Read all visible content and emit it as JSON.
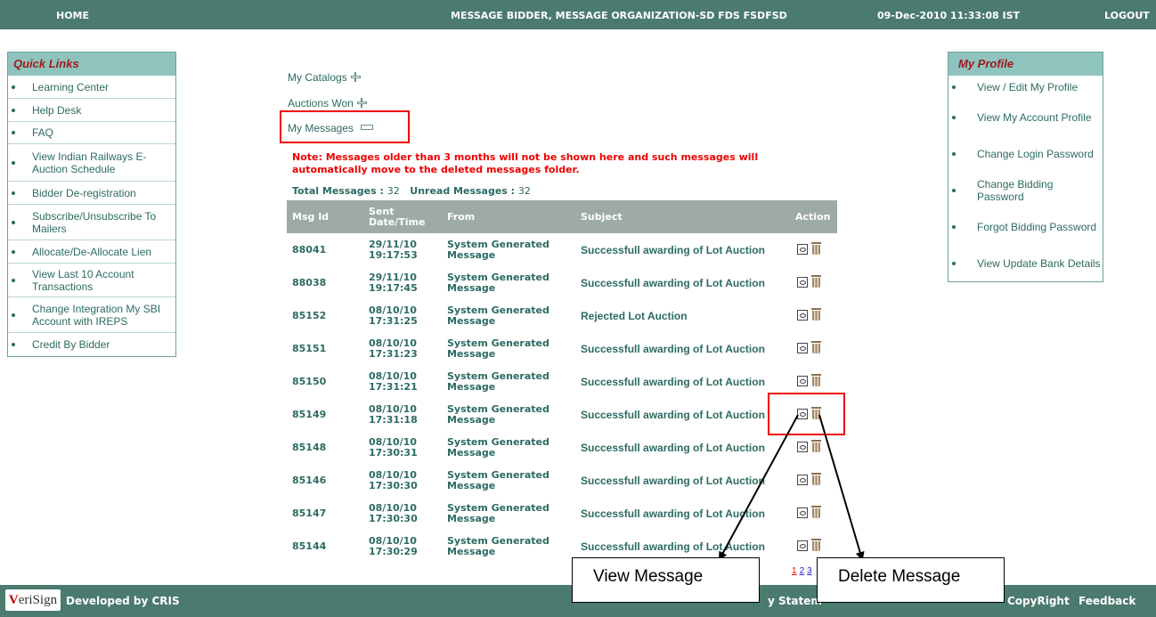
{
  "header": {
    "home": "HOME",
    "user": "MESSAGE BIDDER, MESSAGE ORGANIZATION-SD FDS FSDFSD",
    "datetime": "09-Dec-2010 11:33:08 IST",
    "logout": "LOGOUT"
  },
  "quick_links": {
    "title": "Quick Links",
    "items": [
      "Learning Center",
      "Help Desk",
      "FAQ",
      "View Indian Railways E-Auction Schedule",
      "Bidder De-registration",
      "Subscribe/Unsubscribe To Mailers",
      "Allocate/De-Allocate Lien",
      "View Last 10 Account Transactions",
      "Change Integration My SBI Account with IREPS",
      "Credit By Bidder"
    ]
  },
  "my_profile": {
    "title": "My Profile",
    "items": [
      "View / Edit My Profile",
      "View My Account Profile",
      "Change Login Password",
      "Change Bidding Password",
      "Forgot Bidding Password",
      "View Update Bank Details"
    ]
  },
  "sections": {
    "catalogs": "My Catalogs",
    "auctions_won": "Auctions Won",
    "messages": "My Messages"
  },
  "note": "Note: Messages older than 3 months will not be shown here and such messages will automatically move to the deleted messages folder.",
  "totals": {
    "total_label": "Total Messages :",
    "total_value": "32",
    "unread_label": "Unread Messages :",
    "unread_value": "32"
  },
  "table": {
    "headers": [
      "Msg Id",
      "Sent Date/Time",
      "From",
      "Subject",
      "Action"
    ],
    "rows": [
      {
        "id": "88041",
        "date": "29/11/10",
        "time": "19:17:53",
        "from": "System Generated Message",
        "subject": "Successfull awarding of Lot Auction"
      },
      {
        "id": "88038",
        "date": "29/11/10",
        "time": "19:17:45",
        "from": "System Generated Message",
        "subject": "Successfull awarding of Lot Auction"
      },
      {
        "id": "85152",
        "date": "08/10/10",
        "time": "17:31:25",
        "from": "System Generated Message",
        "subject": "Rejected Lot Auction"
      },
      {
        "id": "85151",
        "date": "08/10/10",
        "time": "17:31:23",
        "from": "System Generated Message",
        "subject": "Successfull awarding of Lot Auction"
      },
      {
        "id": "85150",
        "date": "08/10/10",
        "time": "17:31:21",
        "from": "System Generated Message",
        "subject": "Successfull awarding of Lot Auction"
      },
      {
        "id": "85149",
        "date": "08/10/10",
        "time": "17:31:18",
        "from": "System Generated Message",
        "subject": "Successfull awarding of Lot Auction"
      },
      {
        "id": "85148",
        "date": "08/10/10",
        "time": "17:30:31",
        "from": "System Generated Message",
        "subject": "Successfull awarding of Lot Auction"
      },
      {
        "id": "85146",
        "date": "08/10/10",
        "time": "17:30:30",
        "from": "System Generated Message",
        "subject": "Successfull awarding of Lot Auction"
      },
      {
        "id": "85147",
        "date": "08/10/10",
        "time": "17:30:30",
        "from": "System Generated Message",
        "subject": "Successfull awarding of Lot Auction"
      },
      {
        "id": "85144",
        "date": "08/10/10",
        "time": "17:30:29",
        "from": "System Generated Message",
        "subject": "Successfull awarding of Lot Auction"
      }
    ]
  },
  "pager": [
    "1",
    "2",
    "3"
  ],
  "callouts": {
    "view": "View Message",
    "delete": "Delete Message"
  },
  "footer": {
    "logo": "VeriSign",
    "developed": "Developed by CRIS",
    "privacy": "y Statem",
    "copyright": "CopyRight",
    "feedback": "Feedback"
  },
  "colors": {
    "header_bg": "#4b7a6e",
    "accent_text": "#2c6b62",
    "panel_head_bg": "#8fc3bd",
    "table_head_bg": "#9eaaa8",
    "note_red": "#e00000"
  }
}
